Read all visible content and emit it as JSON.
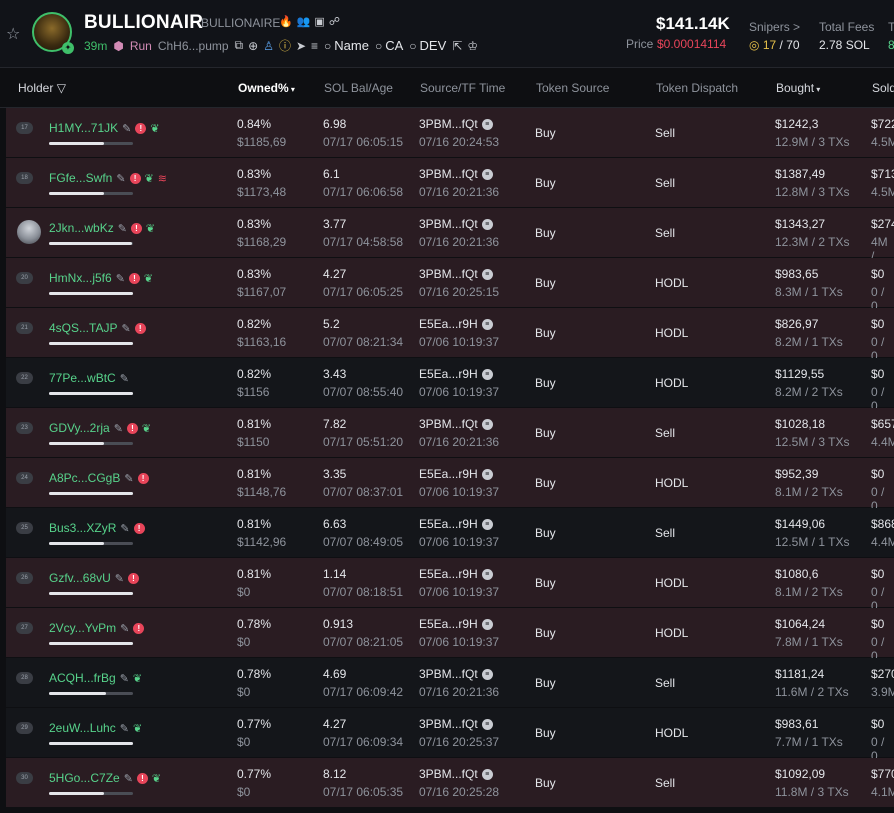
{
  "token": {
    "name": "BULLIONAIR",
    "ticker": "BULLIONAIRE",
    "age": "39m",
    "run_label": "Run",
    "ca_short": "ChH6...pump",
    "links": [
      "Name",
      "CA",
      "DEV"
    ],
    "market_cap": "$141.14K",
    "price_label": "Price",
    "price": "$0.00014114",
    "snipers_label": "Snipers >",
    "snipers_value": "17",
    "snipers_total": "/ 70",
    "fees_label": "Total Fees",
    "fees_value": "2.78 SOL",
    "cut_label": "T",
    "cut_value": "8"
  },
  "columns": {
    "holder": "Holder",
    "owned": "Owned%",
    "sol_bal": "SOL Bal/Age",
    "source_tf": "Source/TF Time",
    "token_source": "Token Source",
    "token_dispatch": "Token Dispatch",
    "bought": "Bought",
    "sold": "Sold"
  },
  "holders": [
    {
      "rank": "17",
      "addr": "H1MY...71JK",
      "owned": "0.84%",
      "usd": "$1185,69",
      "sol": "6.98",
      "age": "07/17 06:05:15",
      "src": "3PBM...fQt",
      "tf": "07/16 20:24:53",
      "token_source": "Buy",
      "dispatch": "Sell",
      "bought": "$1242,3",
      "bought_sub": "12.9M / 3 TXs",
      "sold": "$722",
      "sold_sub": "4.5M",
      "bar": 0.65
    },
    {
      "rank": "18",
      "addr": "FGfe...Swfn",
      "owned": "0.83%",
      "usd": "$1173,48",
      "sol": "6.1",
      "age": "07/17 06:06:58",
      "src": "3PBM...fQt",
      "tf": "07/16 20:21:36",
      "token_source": "Buy",
      "dispatch": "Sell",
      "bought": "$1387,49",
      "bought_sub": "12.8M / 3 TXs",
      "sold": "$713",
      "sold_sub": "4.5M",
      "bar": 0.65
    },
    {
      "rank": "19",
      "addr": "2Jkn...wbKz",
      "owned": "0.83%",
      "usd": "$1168,29",
      "sol": "3.77",
      "age": "07/17 04:58:58",
      "src": "3PBM...fQt",
      "tf": "07/16 20:21:36",
      "token_source": "Buy",
      "dispatch": "Sell",
      "bought": "$1343,27",
      "bought_sub": "12.3M / 2 TXs",
      "sold": "$274",
      "sold_sub": "4M /",
      "bar": 0.99
    },
    {
      "rank": "20",
      "addr": "HmNx...j5f6",
      "owned": "0.83%",
      "usd": "$1167,07",
      "sol": "4.27",
      "age": "07/17 06:05:25",
      "src": "3PBM...fQt",
      "tf": "07/16 20:25:15",
      "token_source": "Buy",
      "dispatch": "HODL",
      "bought": "$983,65",
      "bought_sub": "8.3M / 1 TXs",
      "sold": "$0",
      "sold_sub": "0 / 0",
      "bar": 1.0
    },
    {
      "rank": "21",
      "addr": "4sQS...TAJP",
      "owned": "0.82%",
      "usd": "$1163,16",
      "sol": "5.2",
      "age": "07/07 08:21:34",
      "src": "E5Ea...r9H",
      "tf": "07/06 10:19:37",
      "token_source": "Buy",
      "dispatch": "HODL",
      "bought": "$826,97",
      "bought_sub": "8.2M / 1 TXs",
      "sold": "$0",
      "sold_sub": "0 / 0",
      "bar": 1.0
    },
    {
      "rank": "22",
      "addr": "77Pe...wBtC",
      "owned": "0.82%",
      "usd": "$1156",
      "sol": "3.43",
      "age": "07/07 08:55:40",
      "src": "E5Ea...r9H",
      "tf": "07/06 10:19:37",
      "token_source": "Buy",
      "dispatch": "HODL",
      "bought": "$1129,55",
      "bought_sub": "8.2M / 2 TXs",
      "sold": "$0",
      "sold_sub": "0 / 0",
      "bar": 1.0
    },
    {
      "rank": "23",
      "addr": "GDVy...2rja",
      "owned": "0.81%",
      "usd": "$1150",
      "sol": "7.82",
      "age": "07/17 05:51:20",
      "src": "3PBM...fQt",
      "tf": "07/16 20:21:36",
      "token_source": "Buy",
      "dispatch": "Sell",
      "bought": "$1028,18",
      "bought_sub": "12.5M / 3 TXs",
      "sold": "$657",
      "sold_sub": "4.4M",
      "bar": 0.65
    },
    {
      "rank": "24",
      "addr": "A8Pc...CGgB",
      "owned": "0.81%",
      "usd": "$1148,76",
      "sol": "3.35",
      "age": "07/07 08:37:01",
      "src": "E5Ea...r9H",
      "tf": "07/06 10:19:37",
      "token_source": "Buy",
      "dispatch": "HODL",
      "bought": "$952,39",
      "bought_sub": "8.1M / 2 TXs",
      "sold": "$0",
      "sold_sub": "0 / 0",
      "bar": 1.0
    },
    {
      "rank": "25",
      "addr": "Bus3...XZyR",
      "owned": "0.81%",
      "usd": "$1142,96",
      "sol": "6.63",
      "age": "07/07 08:49:05",
      "src": "E5Ea...r9H",
      "tf": "07/06 10:19:37",
      "token_source": "Buy",
      "dispatch": "Sell",
      "bought": "$1449,06",
      "bought_sub": "12.5M / 1 TXs",
      "sold": "$868",
      "sold_sub": "4.4M",
      "bar": 0.65
    },
    {
      "rank": "26",
      "addr": "Gzfv...68vU",
      "owned": "0.81%",
      "usd": "$0",
      "sol": "1.14",
      "age": "07/07 08:18:51",
      "src": "E5Ea...r9H",
      "tf": "07/06 10:19:37",
      "token_source": "Buy",
      "dispatch": "HODL",
      "bought": "$1080,6",
      "bought_sub": "8.1M / 2 TXs",
      "sold": "$0",
      "sold_sub": "0 / 0",
      "bar": 1.0
    },
    {
      "rank": "27",
      "addr": "2Vcy...YvPm",
      "owned": "0.78%",
      "usd": "$0",
      "sol": "0.913",
      "age": "07/07 08:21:05",
      "src": "E5Ea...r9H",
      "tf": "07/06 10:19:37",
      "token_source": "Buy",
      "dispatch": "HODL",
      "bought": "$1064,24",
      "bought_sub": "7.8M / 1 TXs",
      "sold": "$0",
      "sold_sub": "0 / 0",
      "bar": 1.0
    },
    {
      "rank": "28",
      "addr": "ACQH...frBg",
      "owned": "0.78%",
      "usd": "$0",
      "sol": "4.69",
      "age": "07/17 06:09:42",
      "src": "3PBM...fQt",
      "tf": "07/16 20:21:36",
      "token_source": "Buy",
      "dispatch": "Sell",
      "bought": "$1181,24",
      "bought_sub": "11.6M / 2 TXs",
      "sold": "$270",
      "sold_sub": "3.9M",
      "bar": 0.68
    },
    {
      "rank": "29",
      "addr": "2euW...Luhc",
      "owned": "0.77%",
      "usd": "$0",
      "sol": "4.27",
      "age": "07/17 06:09:34",
      "src": "3PBM...fQt",
      "tf": "07/16 20:25:37",
      "token_source": "Buy",
      "dispatch": "HODL",
      "bought": "$983,61",
      "bought_sub": "7.7M / 1 TXs",
      "sold": "$0",
      "sold_sub": "0 / 0",
      "bar": 1.0
    },
    {
      "rank": "30",
      "addr": "5HGo...C7Ze",
      "owned": "0.77%",
      "usd": "$0",
      "sol": "8.12",
      "age": "07/17 06:05:35",
      "src": "3PBM...fQt",
      "tf": "07/16 20:25:28",
      "token_source": "Buy",
      "dispatch": "Sell",
      "bought": "$1092,09",
      "bought_sub": "11.8M / 3 TXs",
      "sold": "$770",
      "sold_sub": "4.1M",
      "bar": 0.65
    }
  ],
  "row_flags": [
    {
      "pencil": true,
      "bang": true,
      "sprout": true,
      "stack": false,
      "avatar": false,
      "plain": false
    },
    {
      "pencil": true,
      "bang": true,
      "sprout": true,
      "stack": true,
      "avatar": false,
      "plain": false
    },
    {
      "pencil": true,
      "bang": true,
      "sprout": true,
      "stack": false,
      "avatar": true,
      "plain": false
    },
    {
      "pencil": true,
      "bang": true,
      "sprout": true,
      "stack": false,
      "avatar": false,
      "plain": false
    },
    {
      "pencil": true,
      "bang": true,
      "sprout": false,
      "stack": false,
      "avatar": false,
      "plain": false
    },
    {
      "pencil": true,
      "bang": false,
      "sprout": false,
      "stack": false,
      "avatar": false,
      "plain": true
    },
    {
      "pencil": true,
      "bang": true,
      "sprout": true,
      "stack": false,
      "avatar": false,
      "plain": false
    },
    {
      "pencil": true,
      "bang": true,
      "sprout": false,
      "stack": false,
      "avatar": false,
      "plain": false
    },
    {
      "pencil": true,
      "bang": true,
      "sprout": false,
      "stack": false,
      "avatar": false,
      "plain": true
    },
    {
      "pencil": true,
      "bang": true,
      "sprout": false,
      "stack": false,
      "avatar": false,
      "plain": false
    },
    {
      "pencil": true,
      "bang": true,
      "sprout": false,
      "stack": false,
      "avatar": false,
      "plain": false
    },
    {
      "pencil": true,
      "bang": false,
      "sprout": true,
      "stack": false,
      "avatar": false,
      "plain": true
    },
    {
      "pencil": true,
      "bang": false,
      "sprout": true,
      "stack": false,
      "avatar": false,
      "plain": true
    },
    {
      "pencil": true,
      "bang": true,
      "sprout": true,
      "stack": false,
      "avatar": false,
      "plain": false
    }
  ]
}
